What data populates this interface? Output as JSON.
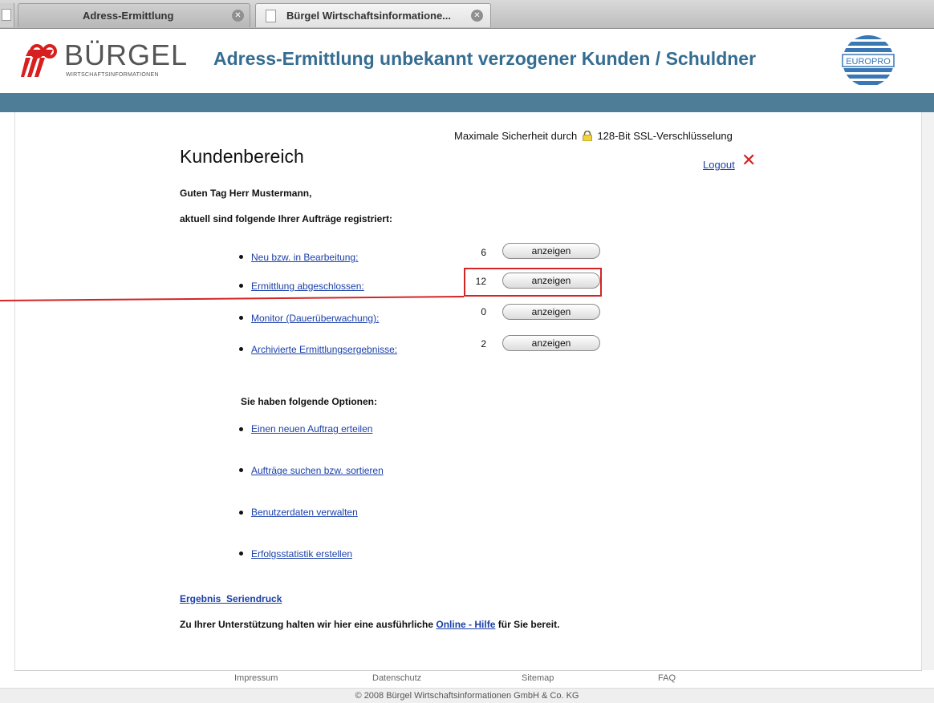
{
  "browser": {
    "tabs": [
      {
        "title": "Adress-Ermittlung"
      },
      {
        "title": "Bürgel Wirtschaftsinformatione..."
      }
    ]
  },
  "header": {
    "logo_text": "BÜRGEL",
    "logo_sub": "WIRTSCHAFTSINFORMATIONEN",
    "title": "Adress-Ermittlung unbekannt verzogener Kunden / Schuldner",
    "partner_logo": "EUROPRO"
  },
  "ssl": {
    "prefix": "Maximale Sicherheit durch",
    "suffix": "128-Bit SSL-Verschlüsselung"
  },
  "page": {
    "title": "Kundenbereich",
    "logout": "Logout",
    "greeting": "Guten Tag Herr Mustermann,",
    "intro": "aktuell sind folgende Ihrer Aufträge registriert:"
  },
  "orders": [
    {
      "label": "Neu bzw. in Bearbeitung:",
      "count": "6",
      "button": "anzeigen"
    },
    {
      "label": "Ermittlung abgeschlossen:",
      "count": "12",
      "button": "anzeigen"
    },
    {
      "label": "Monitor (Dauerüberwachung):",
      "count": "0",
      "button": "anzeigen"
    },
    {
      "label": "Archivierte Ermittlungsergebnisse:",
      "count": "2",
      "button": "anzeigen"
    }
  ],
  "options": {
    "heading": "Sie haben folgende Optionen:",
    "items": [
      "Einen neuen Auftrag erteilen",
      "Aufträge suchen bzw. sortieren",
      "Benutzerdaten verwalten",
      "Erfolgsstatistik erstellen"
    ]
  },
  "serien": "Ergebnis_Seriendruck",
  "support": {
    "before": "Zu Ihrer Unterstützung halten wir hier eine ausführliche",
    "link": "Online - Hilfe",
    "after": "für Sie bereit."
  },
  "footer": {
    "links": [
      "Impressum",
      "Datenschutz",
      "Sitemap",
      "FAQ"
    ],
    "copyright": "© 2008 Bürgel Wirtschaftsinformationen GmbH & Co. KG"
  },
  "colors": {
    "brand_blue": "#356d92",
    "bar_blue": "#4e7d98",
    "link_blue": "#1a3fa8",
    "highlight_red": "#d42525",
    "logo_red": "#d62020"
  }
}
